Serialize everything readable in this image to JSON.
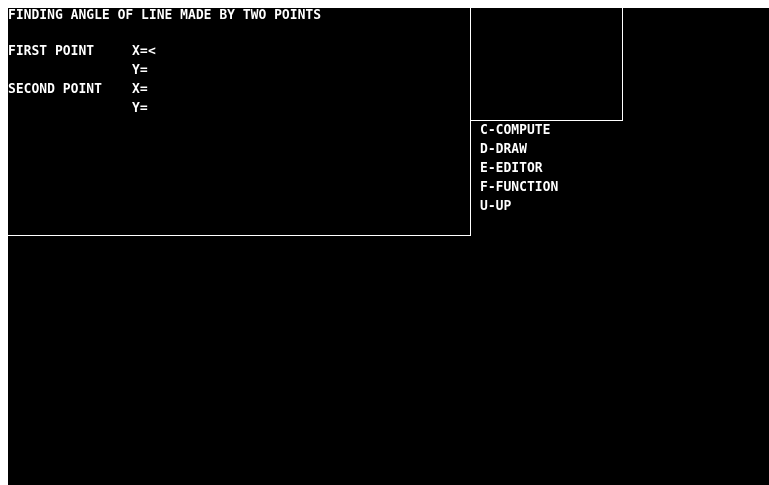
{
  "title": "FINDING ANGLE OF LINE MADE BY TWO POINTS",
  "form": {
    "first_point_label": "FIRST POINT",
    "first_x_label": "X=",
    "first_x_cursor": "<",
    "first_y_label": "Y=",
    "second_point_label": "SECOND POINT",
    "second_x_label": "X=",
    "second_y_label": "Y="
  },
  "menu": {
    "items": [
      {
        "label": "C-COMPUTE"
      },
      {
        "label": "D-DRAW"
      },
      {
        "label": "E-EDITOR"
      },
      {
        "label": "F-FUNCTION"
      },
      {
        "label": "U-UP"
      }
    ]
  },
  "colors": {
    "background": "#000000",
    "foreground": "#ffffff"
  }
}
